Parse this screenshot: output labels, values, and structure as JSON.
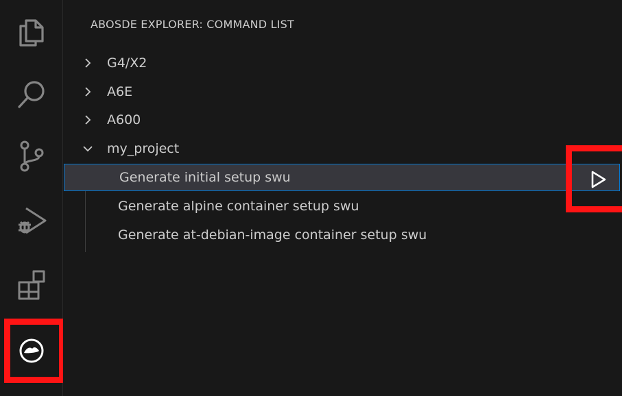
{
  "panel": {
    "title": "ABOSDE EXPLORER: COMMAND LIST"
  },
  "tree": {
    "items": [
      {
        "label": "G4/X2",
        "expanded": false
      },
      {
        "label": "A6E",
        "expanded": false
      },
      {
        "label": "A600",
        "expanded": false
      },
      {
        "label": "my_project",
        "expanded": true,
        "children": [
          {
            "label": "Generate initial setup swu",
            "selected": true
          },
          {
            "label": "Generate alpine container setup swu"
          },
          {
            "label": "Generate at-debian-image container setup swu"
          }
        ]
      }
    ]
  },
  "icons": {
    "activity": [
      "explorer-icon",
      "search-icon",
      "source-control-icon",
      "run-debug-icon",
      "extensions-icon",
      "abosde-icon"
    ],
    "run": "play-icon"
  },
  "colors": {
    "background": "#181818",
    "text": "#cccccc",
    "selection": "#37373d",
    "focus_border": "#0078d4",
    "highlight": "#ff1414"
  }
}
